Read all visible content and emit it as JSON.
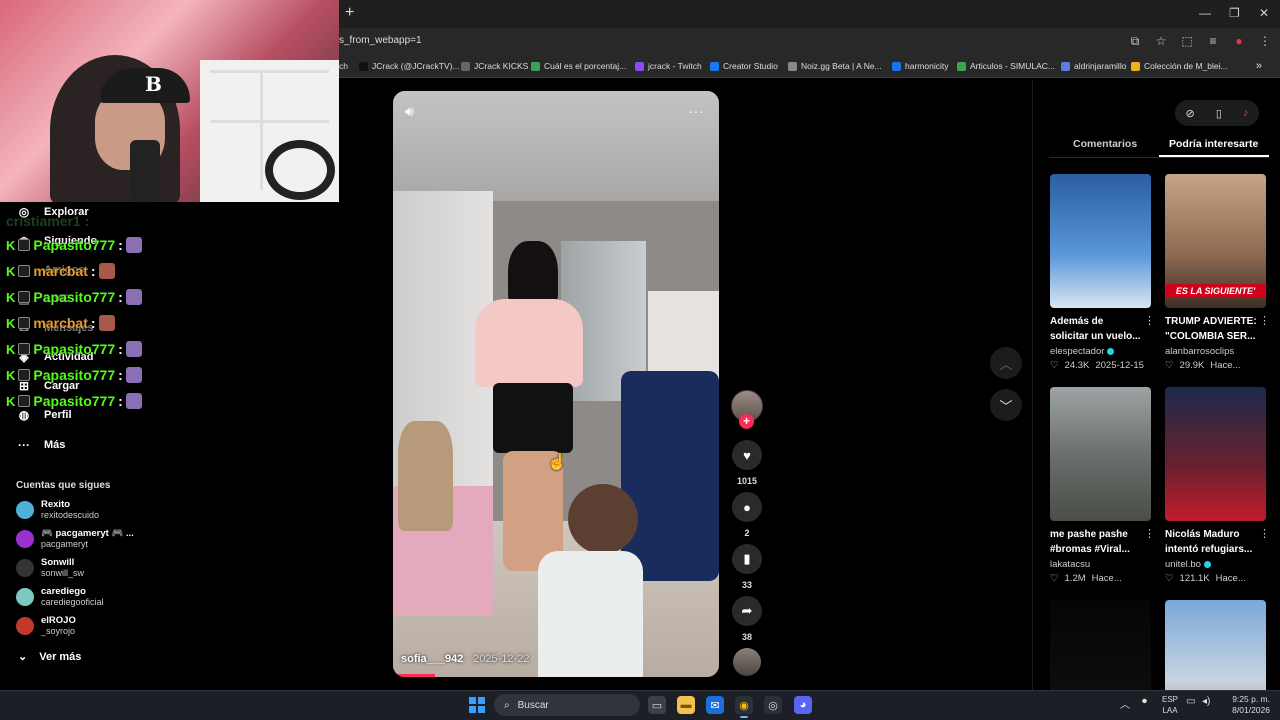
{
  "browser": {
    "url_fragment": "s_from_webapp=1",
    "bookmarks": [
      {
        "label": "ch",
        "color": "#282828"
      },
      {
        "label": "JCrack (@JCrackTV)...",
        "color": "#111111"
      },
      {
        "label": "JCrack KICKS",
        "color": "#666666"
      },
      {
        "label": "Cuál es el porcentaj...",
        "color": "#3aa35a"
      },
      {
        "label": "jcrack - Twitch",
        "color": "#9146ff"
      },
      {
        "label": "Creator Studio",
        "color": "#1877f2"
      },
      {
        "label": "Noiz.gg Beta | A Ne...",
        "color": "#888888"
      },
      {
        "label": "harmonicity",
        "color": "#1a73e8"
      },
      {
        "label": "Articulos - SIMULAC...",
        "color": "#34a853"
      },
      {
        "label": "aldrinjaramillo",
        "color": "#5b7fd6"
      },
      {
        "label": "Colección de M_blei...",
        "color": "#f2b01e"
      }
    ]
  },
  "sidebar": {
    "nav": [
      {
        "label": "Explorar",
        "icon": "compass-icon"
      },
      {
        "label": "Siguiendo",
        "icon": "following-icon"
      },
      {
        "label": "Amigos",
        "icon": "friends-icon"
      },
      {
        "label": "LIVE",
        "icon": "live-icon"
      },
      {
        "label": "Mensajes",
        "icon": "messages-icon"
      },
      {
        "label": "Actividad",
        "icon": "activity-icon"
      },
      {
        "label": "Cargar",
        "icon": "upload-icon"
      },
      {
        "label": "Perfil",
        "icon": "profile-icon"
      },
      {
        "label": "Más",
        "icon": "more-icon"
      }
    ],
    "following_title": "Cuentas que sigues",
    "accounts": [
      {
        "name": "Rexito",
        "handle": "rexitodescuido",
        "color": "#4fb0d8"
      },
      {
        "name": "🎮 pacgameryt 🎮 ...",
        "handle": "pacgameryt",
        "color": "#9b2fd1"
      },
      {
        "name": "Sonwill",
        "handle": "sonwill_sw",
        "color": "#333333"
      },
      {
        "name": "carediego",
        "handle": "carediegooficial",
        "color": "#7cc7c0"
      },
      {
        "name": "elROJO",
        "handle": "_soyrojo",
        "color": "#c0392b"
      }
    ],
    "see_more": "Ver más"
  },
  "chat": {
    "ghost": "cristiamer1 :",
    "lines": [
      {
        "user": "Papasito777",
        "style": "green",
        "emote": "#8a6fb5"
      },
      {
        "user": "marcbat",
        "style": "orange",
        "emote": "#a85a4a"
      },
      {
        "user": "Papasito777",
        "style": "green",
        "emote": "#8a6fb5"
      },
      {
        "user": "marcbat",
        "style": "orange",
        "emote": "#a85a4a"
      },
      {
        "user": "Papasito777",
        "style": "green",
        "emote": "#8a6fb5"
      },
      {
        "user": "Papasito777",
        "style": "green",
        "emote": "#8a6fb5"
      },
      {
        "user": "Papasito777",
        "style": "green",
        "emote": "#8a6fb5"
      }
    ]
  },
  "video": {
    "author": "sofia___942",
    "date": "· 2025-12-22",
    "progress": 0.13
  },
  "rail": {
    "likes": "1015",
    "comments": "2",
    "saves": "33",
    "shares": "38"
  },
  "rpanel": {
    "tab_comments": "Comentarios",
    "tab_related": "Podría interesarte",
    "cards": [
      {
        "title": "Además de",
        "title2": "solicitar un vuelo...",
        "author": "elespectador",
        "verified": true,
        "likes": "24.3K",
        "when": "2025-12-15",
        "thumb": "linear-gradient(#2a5fa0,#5a96d8 60%,#d9e6f2)",
        "banner": ""
      },
      {
        "title": "TRUMP ADVIERTE:",
        "title2": "\"COLOMBIA SER...",
        "author": "alanbarrosoclips",
        "verified": false,
        "likes": "29.9K",
        "when": "Hace...",
        "thumb": "linear-gradient(#c8a486,#8c6a50 60%,#3e3028)",
        "banner": "ES LA SIGUIENTE'"
      },
      {
        "title": "me pashe pashe",
        "title2": "#bromas #Viral...",
        "author": "lakatacsu",
        "verified": false,
        "likes": "1.2M",
        "when": "Hace...",
        "thumb": "linear-gradient(#9da3a4,#6b706d 50%,#4a4d48)",
        "banner": ""
      },
      {
        "title": "Nicolás Maduro",
        "title2": "intentó refugiars...",
        "author": "unitel.bo",
        "verified": true,
        "likes": "121.1K",
        "when": "Hace...",
        "thumb": "linear-gradient(#1d2a4a,#6b2030 60%,#c21c2c)",
        "banner": ""
      },
      {
        "title": "",
        "title2": "",
        "author": "",
        "verified": false,
        "likes": "",
        "when": "",
        "thumb": "linear-gradient(#050505,#111111)",
        "banner": ""
      },
      {
        "title": "",
        "title2": "",
        "author": "",
        "verified": false,
        "likes": "",
        "when": "",
        "thumb": "linear-gradient(#7aa8d8,#c8d4e0 60%,#9a8f86)",
        "banner": ""
      }
    ]
  },
  "taskbar": {
    "search_placeholder": "Buscar",
    "lang_top": "ESP",
    "lang_bottom": "LAA",
    "time": "9:25 p. m.",
    "date": "8/01/2026"
  }
}
